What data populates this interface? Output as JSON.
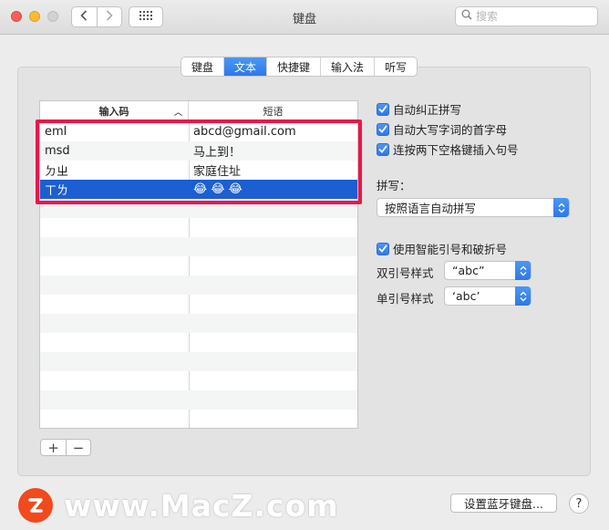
{
  "window": {
    "title": "键盘"
  },
  "search": {
    "placeholder": "搜索"
  },
  "tabs": [
    {
      "label": "键盘",
      "active": false
    },
    {
      "label": "文本",
      "active": true
    },
    {
      "label": "快捷键",
      "active": false
    },
    {
      "label": "输入法",
      "active": false
    },
    {
      "label": "听写",
      "active": false
    }
  ],
  "table": {
    "columns": [
      "输入码",
      "短语"
    ],
    "rows": [
      {
        "code": "eml",
        "phrase": "abcd@gmail.com"
      },
      {
        "code": "msd",
        "phrase": "马上到！"
      },
      {
        "code": "ㄉㄓ",
        "phrase": "家庭住址"
      },
      {
        "code": "ㄒㄌ",
        "phrase": "😂 😂 😂",
        "selected": true
      }
    ]
  },
  "buttons": {
    "add": "+",
    "remove": "−",
    "setup_bluetooth": "设置蓝牙键盘...",
    "help": "?"
  },
  "options": {
    "autocorrect": "自动纠正拼写",
    "autocapitalize": "自动大写字词的首字母",
    "double_space_period": "连按两下空格键插入句号",
    "spelling_label": "拼写：",
    "spelling_value": "按照语言自动拼写",
    "smart_quotes": "使用智能引号和破折号",
    "double_quote_label": "双引号样式",
    "double_quote_value": "“abc”",
    "single_quote_label": "单引号样式",
    "single_quote_value": "‘abc’"
  },
  "watermark": {
    "text": "www.MacZ.com"
  },
  "colors": {
    "accent": "#2e78e8",
    "selection": "#1b5fd2",
    "highlight_box": "#e8174a",
    "watermark_logo": "#f04a1d"
  }
}
